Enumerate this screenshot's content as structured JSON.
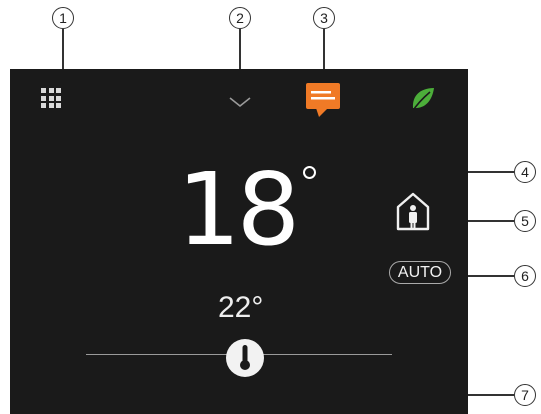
{
  "callouts": [
    "1",
    "2",
    "3",
    "4",
    "5",
    "6",
    "7"
  ],
  "thermostat": {
    "current_temperature": "18",
    "setpoint": "22°",
    "mode_button_label": "AUTO"
  },
  "icons": {
    "menu": "grid-menu-icon",
    "collapse": "chevron-down-icon",
    "messages": "message-icon",
    "eco": "leaf-icon",
    "occupancy": "home-person-icon",
    "slider_handle": "thermometer-icon"
  },
  "colors": {
    "screen_background": "#1a1a1a",
    "message_accent": "#f07a26",
    "eco_accent": "#4cae3a",
    "text": "#ffffff"
  }
}
